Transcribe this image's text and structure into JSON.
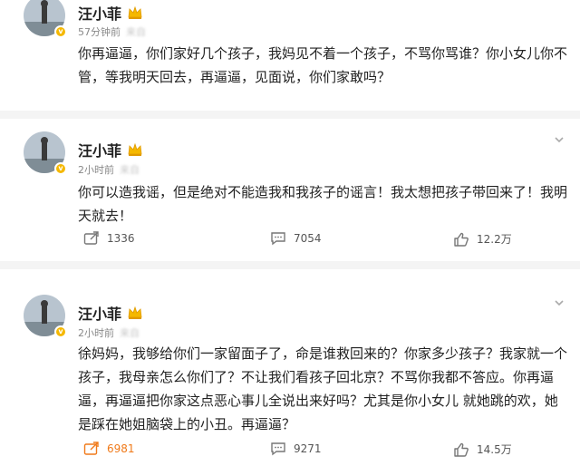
{
  "posts": [
    {
      "username": "汪小菲",
      "time": "57分钟前",
      "source": "来自",
      "text": "你再逼逼，你们家好几个孩子，我妈见不着一个孩子，不骂你骂谁？你小女儿你不管，等我明天回去，再逼逼，见面说，你们家敢吗？"
    },
    {
      "username": "汪小菲",
      "time": "2小时前",
      "source": "来自",
      "text": "你可以造我谣，但是绝对不能造我和我孩子的谣言！我太想把孩子带回来了！我明天就去！",
      "reposts": "1336",
      "comments": "7054",
      "likes": "12.2万"
    },
    {
      "username": "汪小菲",
      "time": "2小时前",
      "source": "来自",
      "text": "徐妈妈，我够给你们一家留面子了，命是谁救回来的？你家多少孩子？我家就一个孩子，我母亲怎么你们了？不让我们看孩子回北京？不骂你我都不答应。你再逼逼，再逼逼把你家这点恶心事儿全说出来好吗？尤其是你小女儿 就她跳的欢，她是踩在她姐脑袋上的小丑。再逼逼？",
      "reposts": "6981",
      "comments": "9271",
      "likes": "14.5万"
    }
  ],
  "colors": {
    "accent": "#f07a1a",
    "badge": "#f5b800",
    "divider": "#f4f4f4"
  },
  "icons": [
    "repost-icon",
    "comment-icon",
    "like-icon",
    "more-chevron-icon",
    "verified-badge-icon",
    "crown-icon"
  ]
}
